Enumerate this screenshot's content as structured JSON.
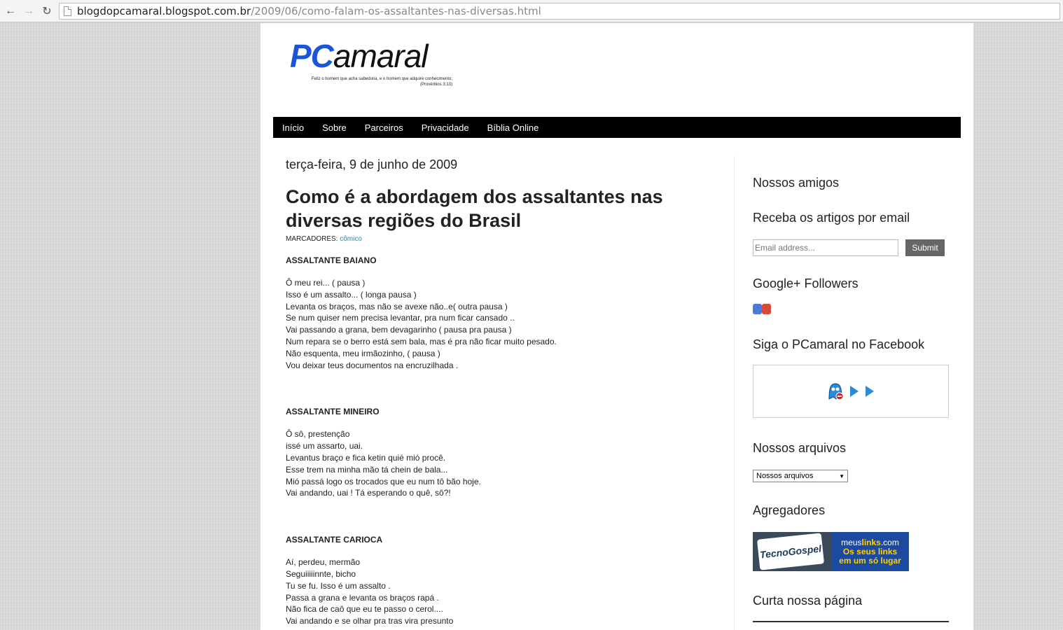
{
  "browser": {
    "url_host": "blogdopcamaral.blogspot.com.br",
    "url_path": "/2009/06/como-falam-os-assaltantes-nas-diversas.html"
  },
  "logo": {
    "pc": "PC",
    "amaral": "amaral",
    "tagline": "Feliz o homem que acha sabedoria, e o homem que adquire conhecimento;",
    "tagline_ref": "(Provérbios 3:13)"
  },
  "menu": {
    "items": [
      "Início",
      "Sobre",
      "Parceiros",
      "Privacidade",
      "Bíblia Online"
    ]
  },
  "post": {
    "date": "terça-feira, 9 de junho de 2009",
    "title": "Como é a abordagem dos assaltantes nas diversas regiões do Brasil",
    "labels_prefix": "MARCADORES:",
    "label": "cômico",
    "sections": [
      {
        "heading": "ASSALTANTE BAIANO",
        "lines": [
          "Ô meu rei... ( pausa )",
          "Isso é um assalto... ( longa pausa )",
          "Levanta os braços, mas não se avexe não..e( outra pausa )",
          "Se num quiser nem precisa levantar, pra num ficar cansado ..",
          "Vai passando a grana, bem devagarinho ( pausa pra pausa )",
          "Num repara se o berro está sem bala, mas é pra não ficar muito pesado.",
          "Não esquenta, meu irmãozinho, ( pausa )",
          "Vou deixar teus documentos na encruzilhada ."
        ]
      },
      {
        "heading": "ASSALTANTE MINEIRO",
        "lines": [
          "Ô sô, prestenção",
          "issé um assarto, uai.",
          "Levantus braço e fica ketin quié mió procê.",
          "Esse trem na minha mão tá chein de bala...",
          "Mió passá logo os trocados que eu num tô bão hoje.",
          "Vai andando, uai ! Tá esperando o quê, sô?!"
        ]
      },
      {
        "heading": "ASSALTANTE CARIOCA",
        "lines": [
          "Aí, perdeu, mermão",
          "Seguiiiiinnte, bicho",
          "Tu se fu. Isso é um assalto .",
          "Passa a grana e levanta os braços rapá .",
          "Não fica de caô que eu te passo o cerol....",
          "Vai andando e se olhar pra tras vira presunto"
        ]
      }
    ]
  },
  "sidebar": {
    "amigos_title": "Nossos amigos",
    "email_title": "Receba os artigos por email",
    "email_placeholder": "Email address...",
    "submit_label": "Submit",
    "gplus_title": "Google+ Followers",
    "facebook_title": "Siga o PCamaral no Facebook",
    "arquivos_title": "Nossos arquivos",
    "arquivos_selected": "Nossos arquivos",
    "agregadores_title": "Agregadores",
    "tecnogospel_label": "TecnoGospel",
    "meuslinks_top": "meus",
    "meuslinks_brand": "links",
    "meuslinks_com": ".com",
    "meuslinks_tag1": "Os seus links",
    "meuslinks_tag2": "em um só lugar",
    "curta_title": "Curta nossa página"
  }
}
